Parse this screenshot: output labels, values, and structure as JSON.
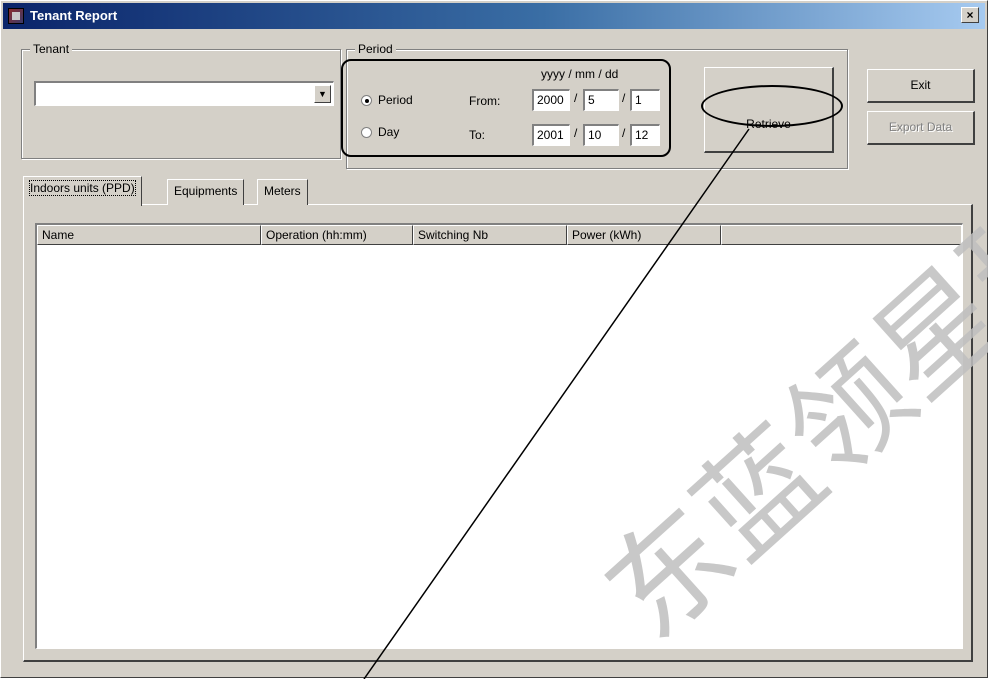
{
  "window": {
    "title": "Tenant Report",
    "close_glyph": "×"
  },
  "tenant": {
    "group_label": "Tenant",
    "selected": "",
    "dropdown_icon": "triangle-down"
  },
  "period": {
    "group_label": "Period",
    "radio_period": "Period",
    "radio_day": "Day",
    "selected_mode": "Period",
    "date_format": "yyyy / mm / dd",
    "from_label": "From:",
    "to_label": "To:",
    "sep": "/",
    "from": {
      "year": "2000",
      "month": "5",
      "day": "1"
    },
    "to": {
      "year": "2001",
      "month": "10",
      "day": "12"
    }
  },
  "buttons": {
    "retrieve": "Retrieve",
    "exit": "Exit",
    "export": "Export Data"
  },
  "tabs": [
    {
      "label": "Indoors units (PPD)",
      "active": true
    },
    {
      "label": "Equipments",
      "active": false
    },
    {
      "label": "Meters",
      "active": false
    }
  ],
  "table": {
    "columns": [
      "Name",
      "Operation (hh:mm)",
      "Switching Nb",
      "Power (kWh)"
    ],
    "rows": []
  },
  "watermark": "东蓝领星球",
  "colors": {
    "titlebar_start": "#0a246a",
    "titlebar_end": "#a6caf0",
    "face": "#d4d0c8"
  }
}
